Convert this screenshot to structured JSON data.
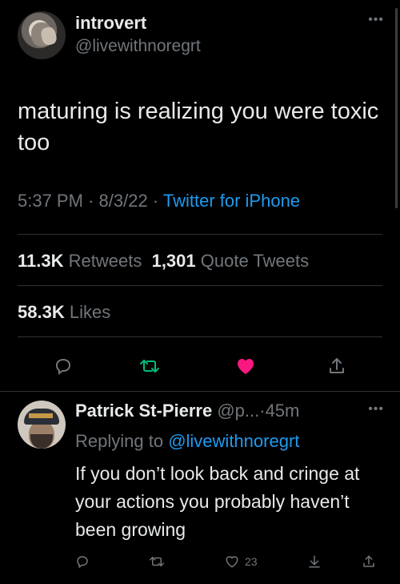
{
  "tweet": {
    "author_name": "introvert",
    "author_handle": "@livewithnoregrt",
    "text": "maturing is realizing you were toxic too",
    "time": "5:37 PM",
    "date": "8/3/22",
    "source": "Twitter for iPhone",
    "separator": "·",
    "retweets_count": "11.3K",
    "retweets_label": "Retweets",
    "quote_count": "1,301",
    "quote_label": "Quote Tweets",
    "likes_count": "58.3K",
    "likes_label": "Likes",
    "liked": true
  },
  "reply": {
    "author_name": "Patrick St-Pierre",
    "author_handle": "@p...",
    "time_ago": "45m",
    "separator": "·",
    "replying_to_label": "Replying to",
    "replying_to_handle": "@livewithnoregrt",
    "text": "If you don’t look back and cringe at your actions you probably haven’t been growing",
    "like_count": "23"
  },
  "colors": {
    "background": "#000000",
    "text": "#e7e9ea",
    "muted": "#71767b",
    "link": "#1d9bf0",
    "retweet": "#00ba7c",
    "like": "#f91880",
    "divider": "#2f3336"
  },
  "icons": [
    "reply-icon",
    "retweet-icon",
    "like-icon",
    "share-icon",
    "more-icon",
    "download-icon"
  ]
}
